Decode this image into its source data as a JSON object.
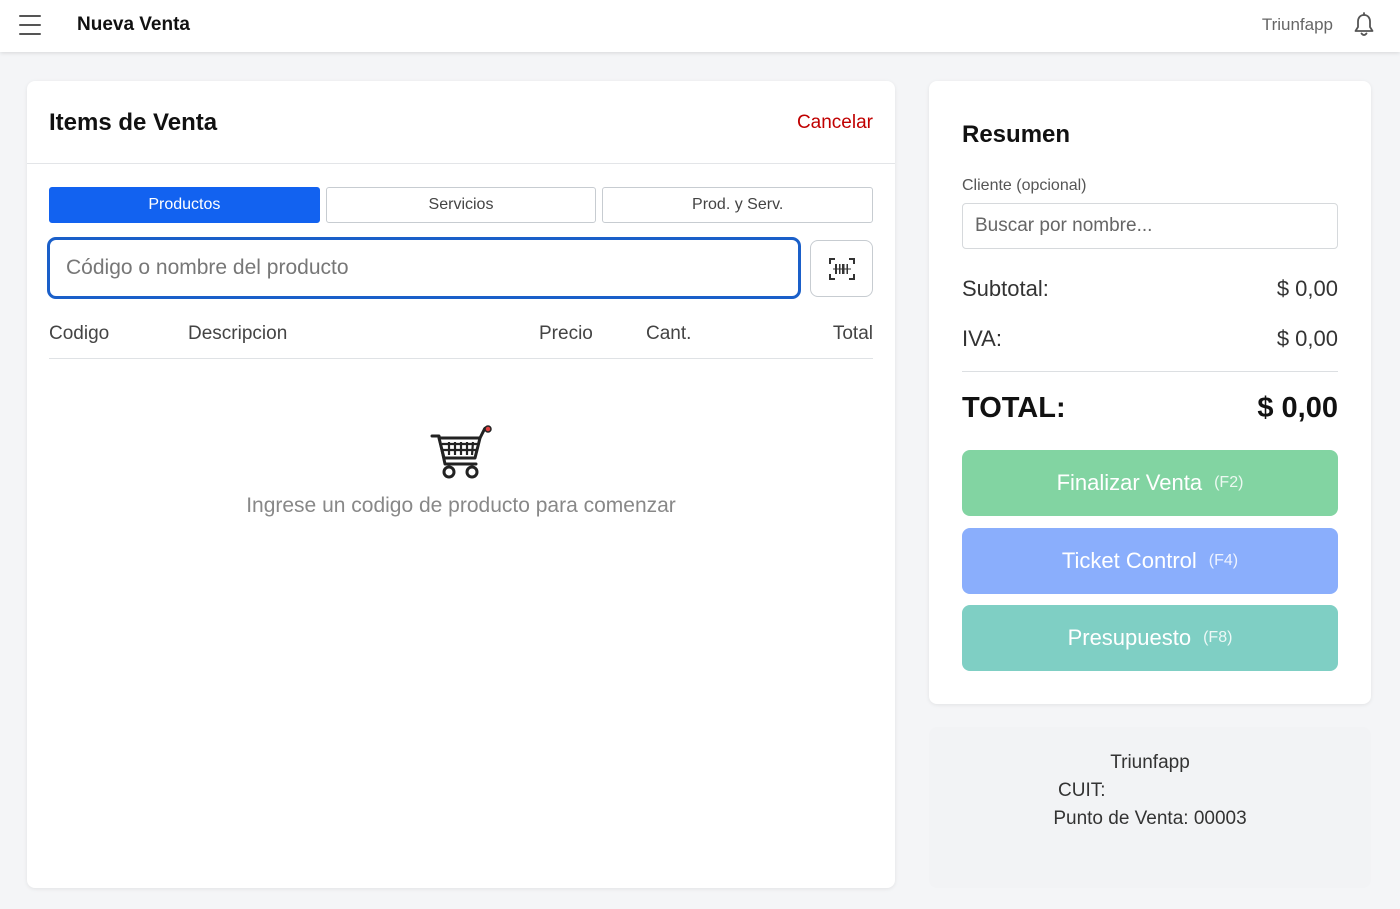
{
  "header": {
    "title": "Nueva Venta",
    "brand": "Triunfapp"
  },
  "items_panel": {
    "title": "Items de Venta",
    "cancel_label": "Cancelar",
    "tabs": [
      {
        "label": "Productos",
        "active": true
      },
      {
        "label": "Servicios",
        "active": false
      },
      {
        "label": "Prod. y Serv.",
        "active": false
      }
    ],
    "search": {
      "placeholder": "Código o nombre del producto",
      "value": ""
    },
    "columns": {
      "codigo": "Codigo",
      "descripcion": "Descripcion",
      "precio": "Precio",
      "cantidad": "Cant.",
      "total": "Total"
    },
    "rows": [],
    "empty_message": "Ingrese un codigo de producto para comenzar",
    "empty_icon": "shopping-cart-icon"
  },
  "summary": {
    "title": "Resumen",
    "client_label": "Cliente (opcional)",
    "client_placeholder": "Buscar por nombre...",
    "subtotal_label": "Subtotal:",
    "subtotal_value": "$ 0,00",
    "iva_label": "IVA:",
    "iva_value": "$ 0,00",
    "total_label": "TOTAL:",
    "total_value": "$ 0,00",
    "actions": [
      {
        "label": "Finalizar Venta",
        "shortcut": "(F2)",
        "color": "#82d4a2"
      },
      {
        "label": "Ticket Control",
        "shortcut": "(F4)",
        "color": "#8aaefc"
      },
      {
        "label": "Presupuesto",
        "shortcut": "(F8)",
        "color": "#7fcfc4"
      }
    ]
  },
  "business_info": {
    "name": "Triunfapp",
    "cuit": "CUIT:",
    "punto_de_venta": "Punto de Venta: 00003"
  },
  "colors": {
    "primary": "#1262f0",
    "cancel": "#c00000",
    "search_border": "#1a5fc9"
  }
}
